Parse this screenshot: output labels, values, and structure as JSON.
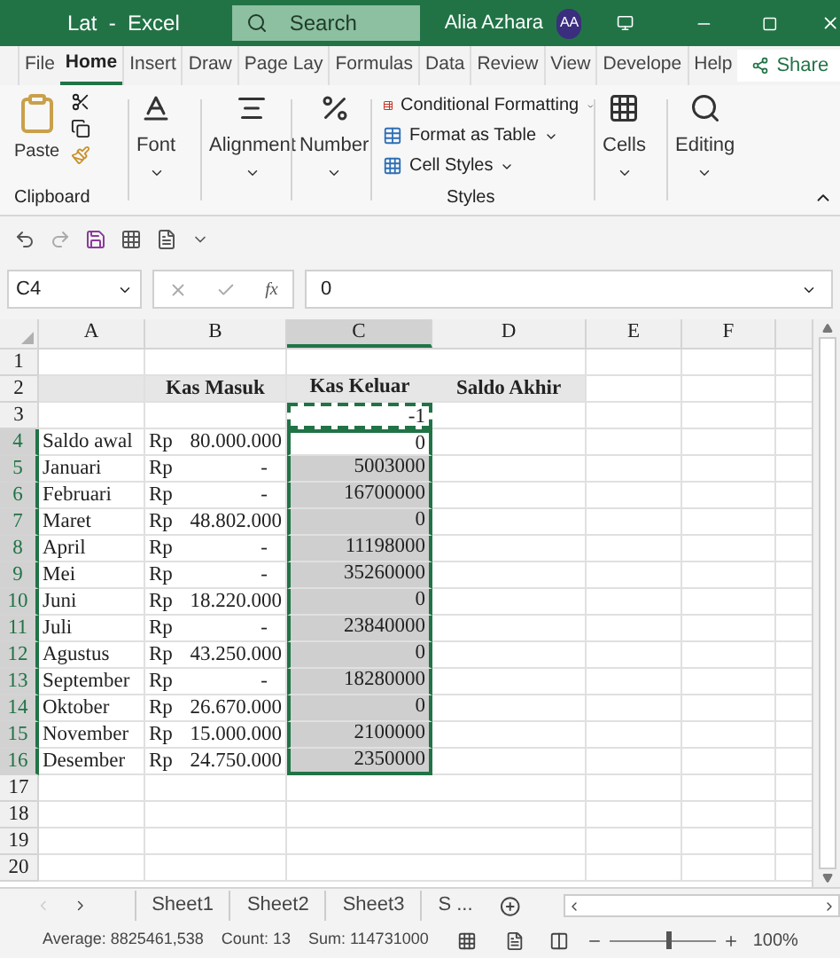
{
  "title_bar": {
    "title": "Lat  -  Excel",
    "search_placeholder": "Search",
    "user": "Alia Azhara",
    "avatar": "AA"
  },
  "ribbon_tabs": [
    {
      "label": "File",
      "selected": false
    },
    {
      "label": "Home",
      "selected": true
    },
    {
      "label": "Insert",
      "selected": false
    },
    {
      "label": "Draw",
      "selected": false
    },
    {
      "label": "Page Lay",
      "selected": false
    },
    {
      "label": "Formulas",
      "selected": false
    },
    {
      "label": "Data",
      "selected": false
    },
    {
      "label": "Review",
      "selected": false
    },
    {
      "label": "View",
      "selected": false
    },
    {
      "label": "Develope",
      "selected": false
    },
    {
      "label": "Help",
      "selected": false
    }
  ],
  "share": "Share",
  "ribbon": {
    "paste": "Paste",
    "clipboard": "Clipboard",
    "font": "Font",
    "alignment": "Alignment",
    "number": "Number",
    "styles": [
      "Conditional Formatting",
      "Format as Table",
      "Cell Styles"
    ],
    "styles_label": "Styles",
    "cells": "Cells",
    "editing": "Editing"
  },
  "name_box": "C4",
  "function_label": "fx",
  "formula": "0",
  "columns": [
    {
      "label": "A",
      "selected": false
    },
    {
      "label": "B",
      "selected": false
    },
    {
      "label": "C",
      "selected": true
    },
    {
      "label": "D",
      "selected": false
    },
    {
      "label": "E",
      "selected": false
    },
    {
      "label": "F",
      "selected": false
    }
  ],
  "rows": [
    {
      "n": "1",
      "selected": false,
      "active": false,
      "marquee": false,
      "shaded": false
    },
    {
      "n": "2",
      "selected": false,
      "active": false,
      "marquee": false,
      "shaded": true,
      "b": "Kas Masuk",
      "c": "Kas Keluar",
      "d": "Saldo Akhir"
    },
    {
      "n": "3",
      "selected": false,
      "active": false,
      "marquee": true,
      "shaded": false,
      "c": "-1"
    },
    {
      "n": "4",
      "selected": true,
      "active": true,
      "marquee": false,
      "shaded": false,
      "a": "Saldo awal",
      "b_prefix": "Rp",
      "b_amount": "80.000.000",
      "c": "0"
    },
    {
      "n": "5",
      "selected": true,
      "active": false,
      "marquee": false,
      "shaded": false,
      "a": "Januari",
      "b_prefix": "Rp",
      "b_amount": "-",
      "c": "5003000"
    },
    {
      "n": "6",
      "selected": true,
      "active": false,
      "marquee": false,
      "shaded": false,
      "a": "Februari",
      "b_prefix": "Rp",
      "b_amount": "-",
      "c": "16700000"
    },
    {
      "n": "7",
      "selected": true,
      "active": false,
      "marquee": false,
      "shaded": false,
      "a": "Maret",
      "b_prefix": "Rp",
      "b_amount": "48.802.000",
      "c": "0"
    },
    {
      "n": "8",
      "selected": true,
      "active": false,
      "marquee": false,
      "shaded": false,
      "a": "April",
      "b_prefix": "Rp",
      "b_amount": "-",
      "c": "11198000"
    },
    {
      "n": "9",
      "selected": true,
      "active": false,
      "marquee": false,
      "shaded": false,
      "a": "Mei",
      "b_prefix": "Rp",
      "b_amount": "-",
      "c": "35260000"
    },
    {
      "n": "10",
      "selected": true,
      "active": false,
      "marquee": false,
      "shaded": false,
      "a": "Juni",
      "b_prefix": "Rp",
      "b_amount": "18.220.000",
      "c": "0"
    },
    {
      "n": "11",
      "selected": true,
      "active": false,
      "marquee": false,
      "shaded": false,
      "a": "Juli",
      "b_prefix": "Rp",
      "b_amount": "-",
      "c": "23840000"
    },
    {
      "n": "12",
      "selected": true,
      "active": false,
      "marquee": false,
      "shaded": false,
      "a": "Agustus",
      "b_prefix": "Rp",
      "b_amount": "43.250.000",
      "c": "0"
    },
    {
      "n": "13",
      "selected": true,
      "active": false,
      "marquee": false,
      "shaded": false,
      "a": "September",
      "b_prefix": "Rp",
      "b_amount": "-",
      "c": "18280000"
    },
    {
      "n": "14",
      "selected": true,
      "active": false,
      "marquee": false,
      "shaded": false,
      "a": "Oktober",
      "b_prefix": "Rp",
      "b_amount": "26.670.000",
      "c": "0"
    },
    {
      "n": "15",
      "selected": true,
      "active": false,
      "marquee": false,
      "shaded": false,
      "a": "November",
      "b_prefix": "Rp",
      "b_amount": "15.000.000",
      "c": "2100000"
    },
    {
      "n": "16",
      "selected": true,
      "active": false,
      "marquee": false,
      "shaded": false,
      "a": "Desember",
      "b_prefix": "Rp",
      "b_amount": "24.750.000",
      "c": "2350000"
    },
    {
      "n": "17",
      "selected": false,
      "active": false,
      "marquee": false,
      "shaded": false
    },
    {
      "n": "18",
      "selected": false,
      "active": false,
      "marquee": false,
      "shaded": false
    },
    {
      "n": "19",
      "selected": false,
      "active": false,
      "marquee": false,
      "shaded": false
    },
    {
      "n": "20",
      "selected": false,
      "active": false,
      "marquee": false,
      "shaded": false
    }
  ],
  "sheets": [
    {
      "label": "Sheet1",
      "selected": false
    },
    {
      "label": "Sheet2",
      "selected": false
    },
    {
      "label": "Sheet3",
      "selected": false
    },
    {
      "label": "S ...",
      "selected": false
    }
  ],
  "status": {
    "average": "Average: 8825461,538",
    "count": "Count: 13",
    "sum": "Sum: 114731000",
    "zoom": {
      "level": 0.55,
      "reading": "100%"
    }
  }
}
